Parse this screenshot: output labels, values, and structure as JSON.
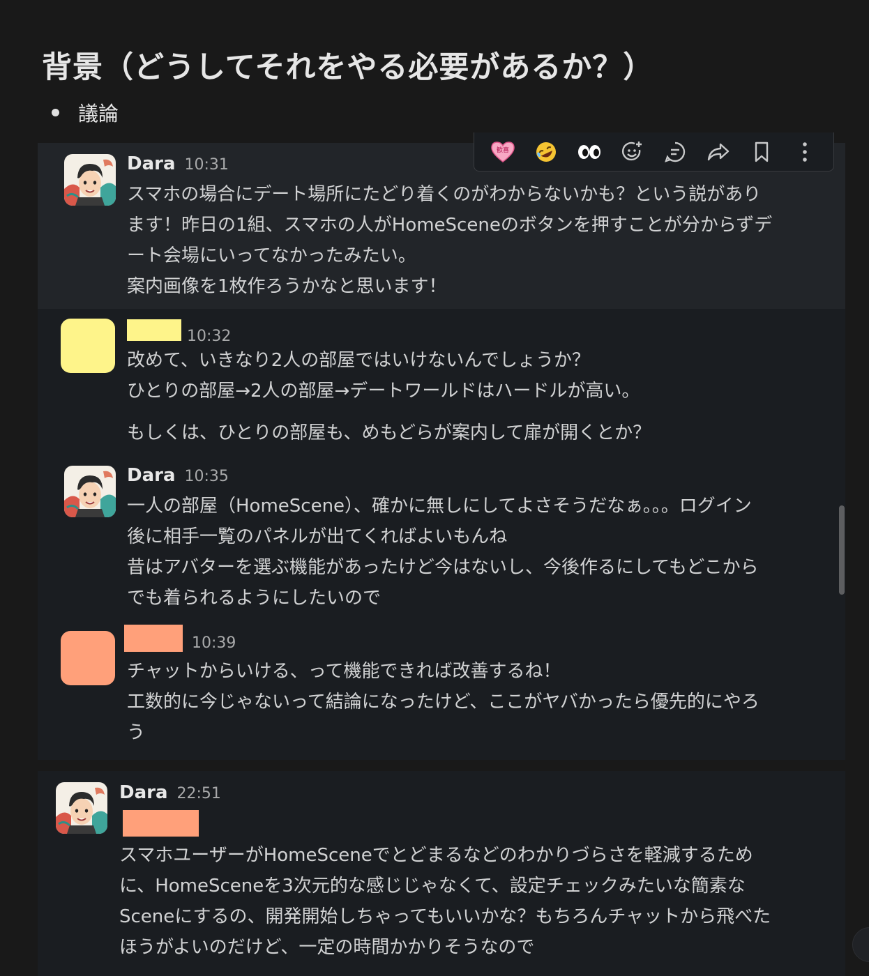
{
  "page": {
    "title": "背景（どうしてそれをやる必要があるか？）",
    "bullet": "議論"
  },
  "toolbar": {
    "items": [
      {
        "icon": "heart-emoji-icon",
        "label": "歓喜"
      },
      {
        "icon": "rofl-emoji-icon"
      },
      {
        "icon": "eyes-emoji-icon"
      },
      {
        "icon": "add-reaction-icon"
      },
      {
        "icon": "reply-thread-icon"
      },
      {
        "icon": "forward-icon"
      },
      {
        "icon": "bookmark-icon"
      },
      {
        "icon": "more-actions-icon"
      }
    ]
  },
  "messages": [
    {
      "author": "Dara",
      "time": "10:31",
      "lines": [
        "スマホの場合にデート場所にたどり着くのがわからないかも？という説があり",
        "ます！昨日の1組、スマホの人がHomeSceneのボタンを押すことが分からずデ",
        "ート会場にいってなかったみたい。",
        "案内画像を1枚作ろうかなと思います！"
      ]
    },
    {
      "author": "",
      "redact_color": "#fef48a",
      "time": "10:32",
      "lines": [
        "改めて、いきなり2人の部屋ではいけないんでしょうか？",
        "ひとりの部屋→2人の部屋→デートワールドはハードルが高い。",
        "もしくは、ひとりの部屋も、めもどらが案内して扉が開くとか？"
      ]
    },
    {
      "author": "Dara",
      "time": "10:35",
      "lines": [
        "一人の部屋（HomeScene）、確かに無しにしてよさそうだなぁ。。。ログイン",
        "後に相手一覧のパネルが出てくればよいもんね",
        "昔はアバターを選ぶ機能があったけど今はないし、今後作るにしてもどこから",
        "でも着られるようにしたいので"
      ]
    },
    {
      "author": "",
      "redact_color": "#ffa07a",
      "time": "10:39",
      "lines": [
        "チャットからいける、って機能できれば改善するね！",
        "工数的に今じゃないって結論になったけど、ここがヤバかったら優先的にやろ",
        "う"
      ]
    },
    {
      "author": "Dara",
      "time": "22:51",
      "mention_color": "#ffa07a",
      "lines": [
        "スマホユーザーがHomeSceneでとどまるなどのわかりづらさを軽減するため",
        "に、HomeSceneを3次元的な感じじゃなくて、設定チェックみたいな簡素な",
        "Sceneにするの、開発開始しちゃってもいいかな？もちろんチャットから飛べた",
        "ほうがよいのだけど、一定の時間かかりそうなので"
      ]
    }
  ]
}
